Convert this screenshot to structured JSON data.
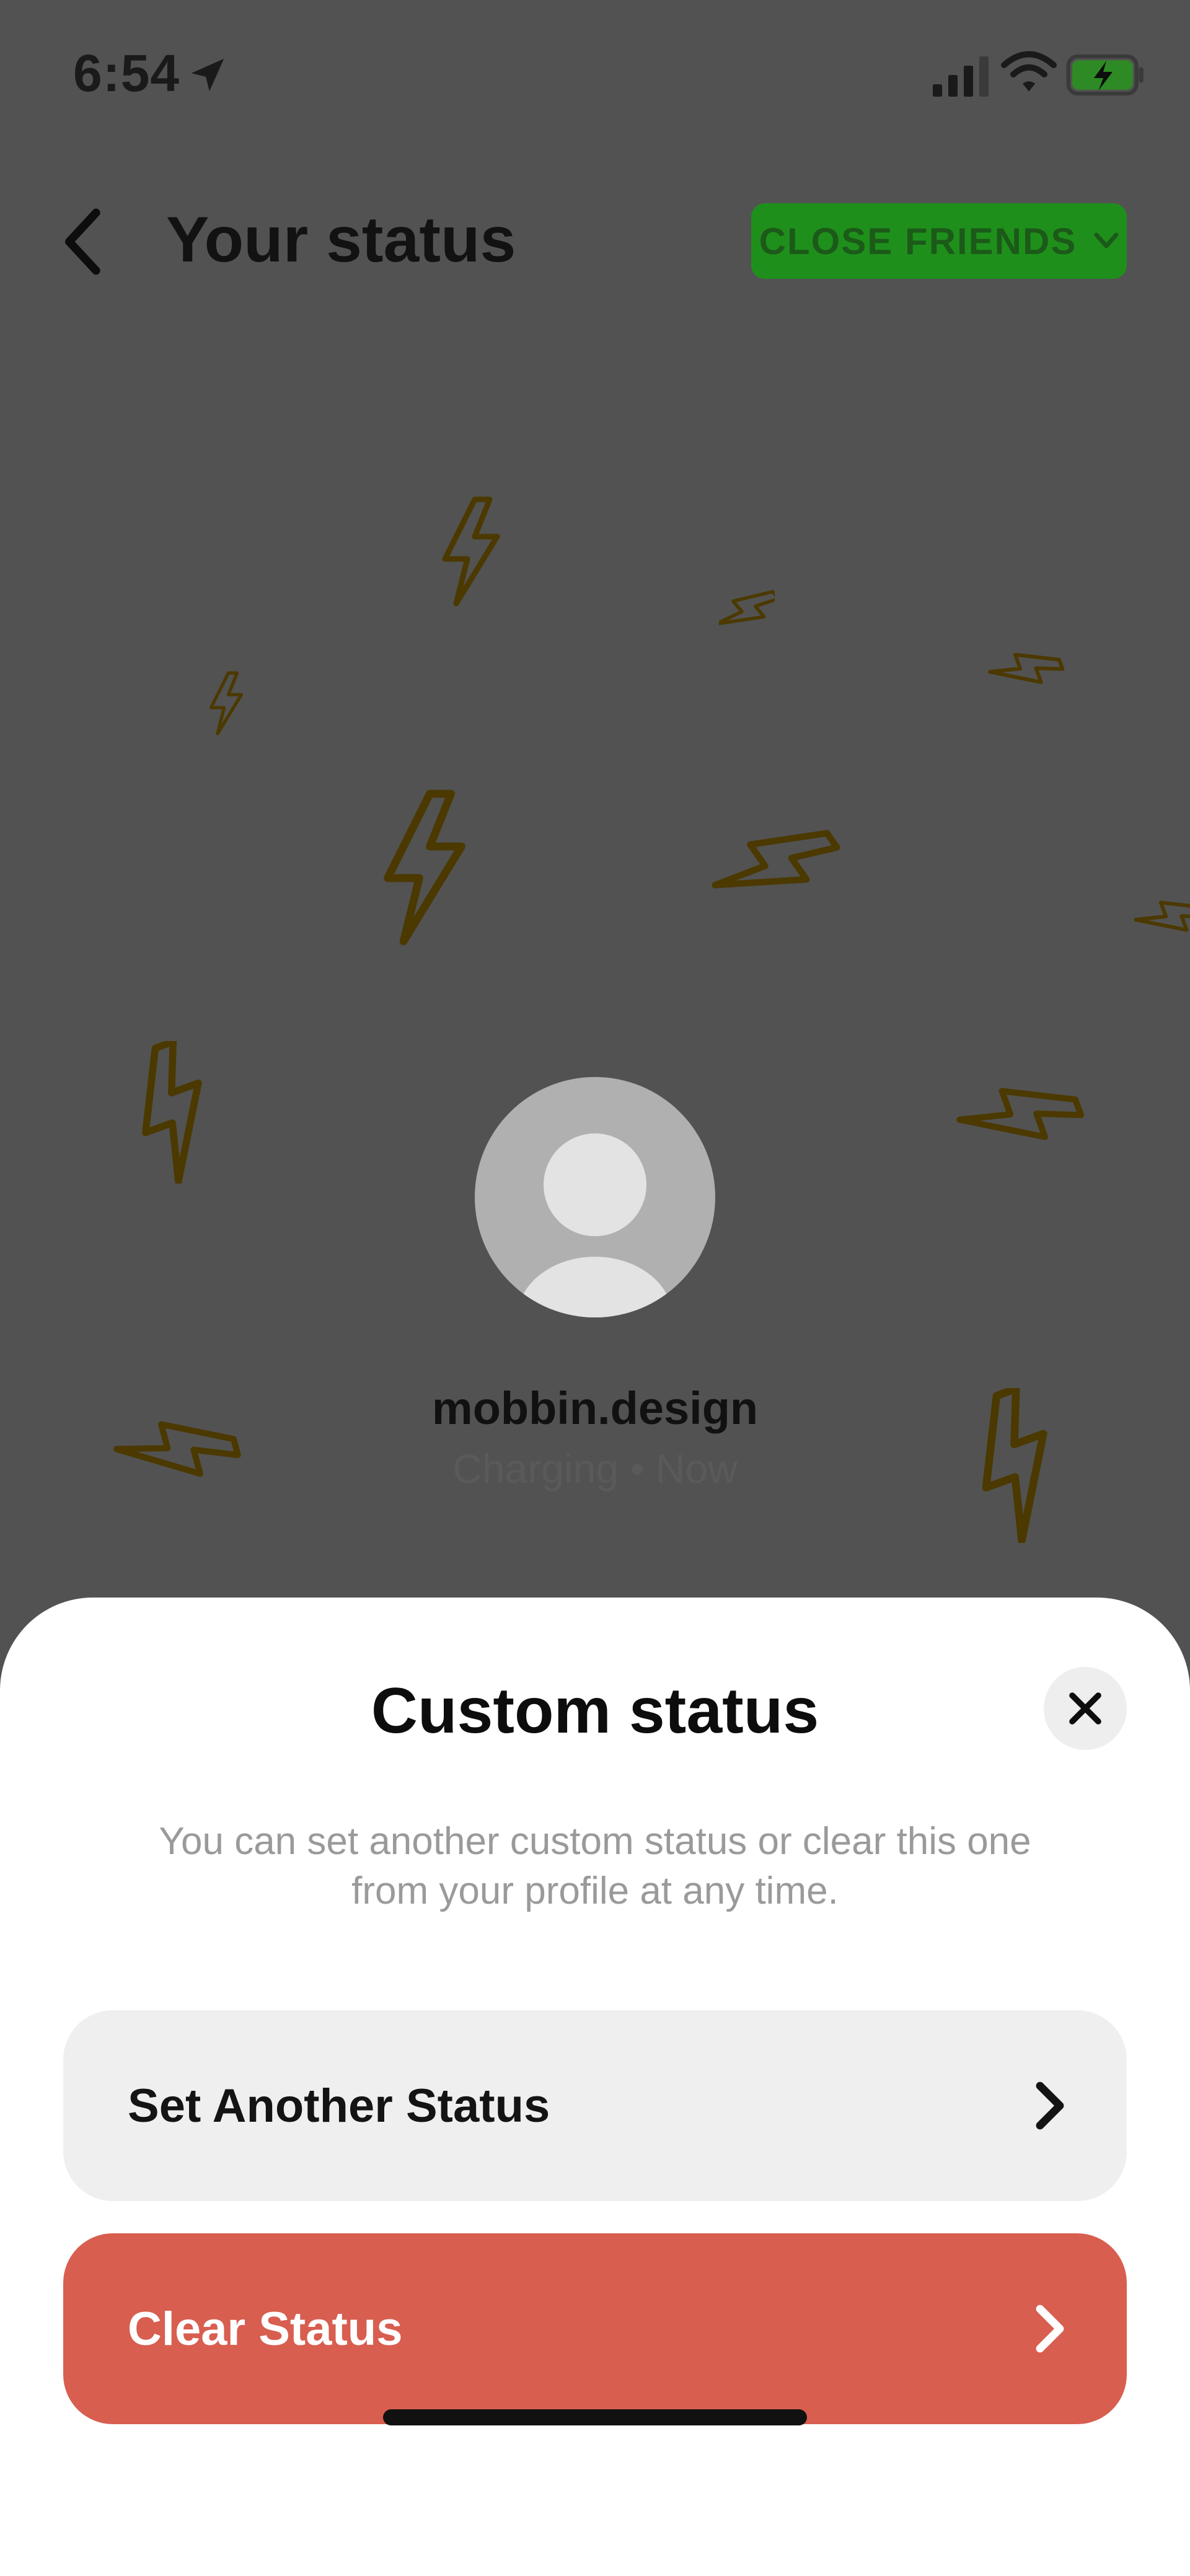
{
  "status_bar": {
    "time": "6:54"
  },
  "header": {
    "title": "Your status",
    "audience_label": "CLOSE FRIENDS"
  },
  "colors": {
    "audience_bg": "#1f8f1c",
    "bolt": "#ffbf00",
    "clear_button": "#d85e50",
    "option_button": "#efefef"
  },
  "profile": {
    "username": "mobbin.design",
    "status": "Charging",
    "time_label": "Now"
  },
  "sheet": {
    "title": "Custom status",
    "description": "You can set another custom status or clear this one from your profile at any time.",
    "options": [
      {
        "label": "Set Another Status",
        "icon": "chevron-right-icon"
      },
      {
        "label": "Clear Status",
        "icon": "chevron-right-icon"
      }
    ]
  }
}
